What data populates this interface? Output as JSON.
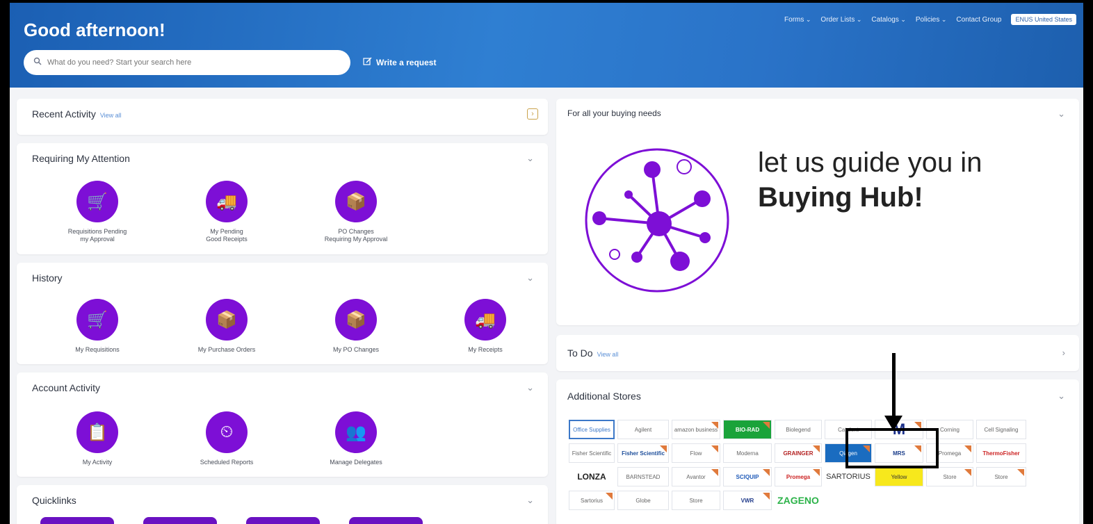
{
  "header": {
    "greeting": "Good afternoon!",
    "search_placeholder": "What do you need? Start your search here",
    "write_request": "Write a request",
    "nav": [
      "Forms",
      "Order Lists",
      "Catalogs",
      "Policies",
      "Contact Group"
    ],
    "locale": "ENUS United States"
  },
  "recent_activity": {
    "title": "Recent Activity",
    "view_all": "View all"
  },
  "requiring_attention": {
    "title": "Requiring My Attention",
    "tiles": [
      {
        "label": "Requisitions Pending\nmy Approval",
        "icon": "cart-icon"
      },
      {
        "label": "My Pending\nGood Receipts",
        "icon": "truck-icon"
      },
      {
        "label": "PO Changes\nRequiring My Approval",
        "icon": "box-icon"
      }
    ]
  },
  "history": {
    "title": "History",
    "tiles": [
      {
        "label": "My Requisitions",
        "icon": "cart-icon"
      },
      {
        "label": "My Purchase Orders",
        "icon": "box-icon"
      },
      {
        "label": "My PO Changes",
        "icon": "box-change-icon"
      },
      {
        "label": "My Receipts",
        "icon": "truck-icon"
      }
    ]
  },
  "account_activity": {
    "title": "Account Activity",
    "tiles": [
      {
        "label": "My Activity",
        "icon": "clipboard-icon"
      },
      {
        "label": "Scheduled Reports",
        "icon": "clock-icon"
      },
      {
        "label": "Manage Delegates",
        "icon": "people-icon"
      }
    ]
  },
  "quicklinks": {
    "title": "Quicklinks"
  },
  "buying_needs": {
    "title": "For all your buying needs",
    "guide_line1": "let us guide you in",
    "guide_line2": "Buying Hub!"
  },
  "todo": {
    "title": "To Do",
    "view_all": "View all"
  },
  "additional_stores": {
    "title": "Additional Stores",
    "stores": [
      "Office Supplies",
      "Agilent",
      "amazon business",
      "BIO-RAD",
      "Biolegend",
      "Catalent",
      "M",
      "Corning",
      "Cell Signaling",
      "Fisher Scientific",
      "Fisher Scientific",
      "Flow",
      "Moderna",
      "GRAINGER",
      "Qiagen",
      "MRS",
      "Promega",
      "ThermoFisher",
      "LONZA",
      "BARNSTEAD",
      "Avantor",
      "SCIQUIP",
      "Promega",
      "SARTORIUS",
      "Yellow",
      "Store",
      "Store",
      "Sartorius",
      "Globe",
      "Store",
      "VWR",
      "ZAGENO"
    ]
  }
}
